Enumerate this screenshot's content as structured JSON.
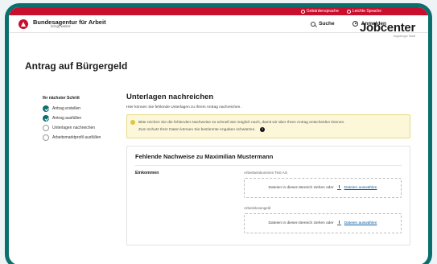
{
  "topbar": {
    "items": [
      "Gebärdensprache",
      "Leichte Sprache"
    ]
  },
  "header": {
    "logo_title": "Bundesagentur für Arbeit",
    "logo_subtitle": "bringt weiter.",
    "search_label": "Suche",
    "login_label": "Anmelden"
  },
  "brand": {
    "jobcenter_title": "Jobcenter",
    "jobcenter_subtitle": "Augsburger Stadt"
  },
  "page_title": "Antrag auf Bürgergeld",
  "steps": {
    "title": "Ihr nächster Schritt",
    "items": [
      {
        "label": "Antrag erstellen",
        "done": true
      },
      {
        "label": "Antrag ausfüllen",
        "done": true
      },
      {
        "label": "Unterlagen nachreichen",
        "done": false
      },
      {
        "label": "Arbeitsmarktprofil ausfüllen",
        "done": false
      }
    ]
  },
  "main": {
    "title": "Unterlagen nachreichen",
    "description": "Hier können Sie fehlende Unterlagen zu Ihrem Antrag nachreichen.",
    "notice_line1": "Bitte reichen Sie die fehlenden Nachweise so schnell wie möglich nach, damit wir über Ihren Antrag entscheiden können.",
    "notice_line2": "Zum Schutz Ihrer Daten können Sie bestimmte Angaben schwärzen."
  },
  "card": {
    "title": "Fehlende Nachweise zu Maximilian Mustermann",
    "section_label": "Einkommen",
    "fields": [
      {
        "label": "Arbeitseinkommen Test AG",
        "drop_text": "Dateien in diesen Bereich ziehen oder",
        "link": "Dateien auswählen"
      },
      {
        "label": "Arbeitslosengeld",
        "drop_text": "Dateien in diesen Bereich ziehen oder",
        "link": "Dateien auswählen"
      }
    ]
  },
  "colors": {
    "accent": "#c8102e",
    "frame": "#0b6f6e",
    "step_done": "#0b6f6e",
    "notice_bg": "#fcf7d9"
  }
}
